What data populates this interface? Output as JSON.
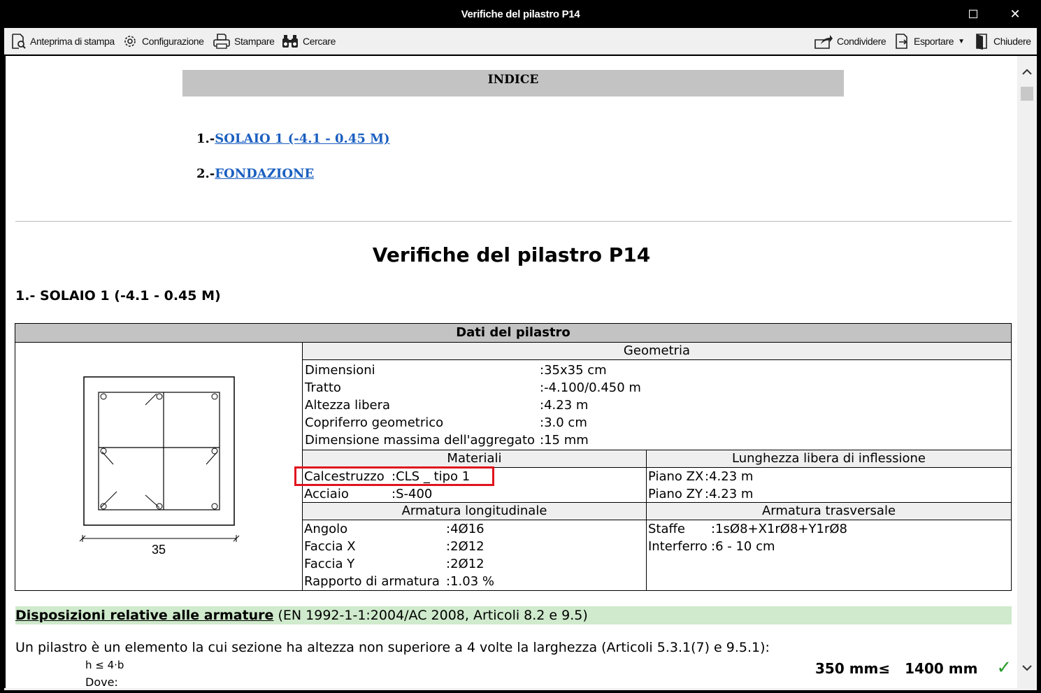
{
  "window": {
    "title": "Verifiche del pilastro P14"
  },
  "toolbar": {
    "print_preview": "Anteprima di stampa",
    "config": "Configurazione",
    "print": "Stampare",
    "search": "Cercare",
    "share": "Condividere",
    "export": "Esportare",
    "close": "Chiudere"
  },
  "index": {
    "header": "INDICE",
    "items": [
      {
        "num": "1.-",
        "label": "SOLAIO 1 (-4.1 - 0.45 M)"
      },
      {
        "num": "2.-",
        "label": "FONDAZIONE"
      }
    ]
  },
  "report": {
    "title": "Verifiche del pilastro P14",
    "section1": "1.- SOLAIO 1 (-4.1 - 0.45 M)"
  },
  "column_table": {
    "header": "Dati del pilastro",
    "dim_label": "35",
    "geometry": {
      "header": "Geometria",
      "rows": [
        {
          "label": "Dimensioni",
          "value": "35x35 cm"
        },
        {
          "label": "Tratto",
          "value": "-4.100/0.450 m"
        },
        {
          "label": "Altezza libera",
          "value": "4.23 m"
        },
        {
          "label": "Copriferro geometrico",
          "value": "3.0 cm"
        },
        {
          "label": "Dimensione massima dell'aggregato",
          "value": "15 mm"
        }
      ]
    },
    "materials": {
      "header": "Materiali",
      "rows": [
        {
          "label": "Calcestruzzo",
          "value": "CLS _ tipo 1"
        },
        {
          "label": "Acciaio",
          "value": "S-400"
        }
      ]
    },
    "buckling": {
      "header": "Lunghezza libera di inflessione",
      "rows": [
        {
          "label": "Piano ZX",
          "value": "4.23 m"
        },
        {
          "label": "Piano ZY",
          "value": "4.23 m"
        }
      ]
    },
    "longitudinal": {
      "header": "Armatura longitudinale",
      "rows": [
        {
          "label": "Angolo",
          "value": "4Ø16"
        },
        {
          "label": "Faccia X",
          "value": "2Ø12"
        },
        {
          "label": "Faccia Y",
          "value": "2Ø12"
        },
        {
          "label": "Rapporto di armatura",
          "value": "1.03 %"
        }
      ]
    },
    "transversal": {
      "header": "Armatura trasversale",
      "rows": [
        {
          "label": "Staffe",
          "value": "1sØ8+X1rØ8+Y1rØ8"
        },
        {
          "label": "Interferro",
          "value": "6 - 10 cm"
        }
      ]
    }
  },
  "dispositions": {
    "title": "Disposizioni relative alle armature",
    "ref": " (EN 1992-1-1:2004/AC 2008, Articoli 8.2 e 9.5)",
    "text": "Un pilastro è un elemento la cui sezione ha altezza non superiore a 4 volte la larghezza (Articoli 5.3.1(7) e 9.5.1):",
    "formula": "h ≤ 4·b",
    "where": "Dove:",
    "check_left": "350 mm≤",
    "check_right": "1400 mm"
  },
  "colors": {
    "highlight_box": "#e0141e",
    "link": "#1a5fc0",
    "green_bar": "#cfeacc",
    "check": "#2a9a2a"
  }
}
